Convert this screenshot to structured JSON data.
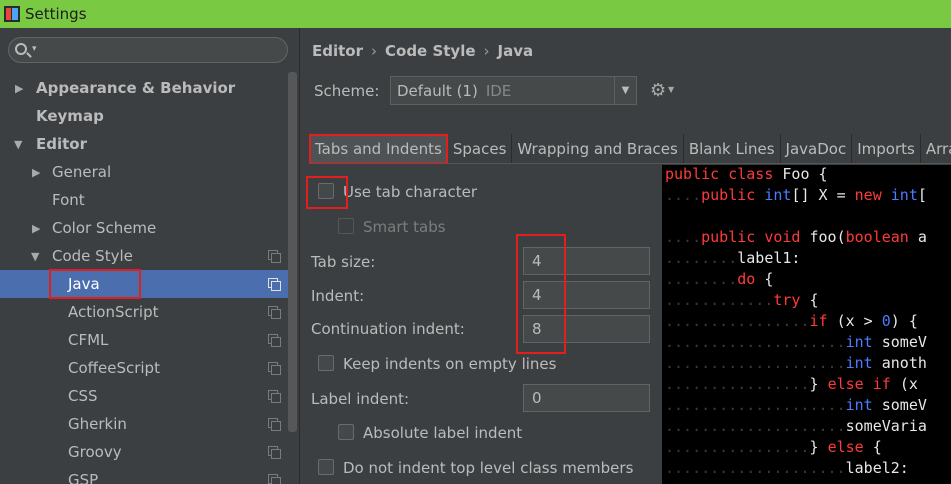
{
  "window": {
    "title": "Settings"
  },
  "sidebar": {
    "search_placeholder": "",
    "items": [
      {
        "label": "Appearance & Behavior",
        "level": 0,
        "arrow": "right",
        "bold": true
      },
      {
        "label": "Keymap",
        "level": 0,
        "arrow": "",
        "bold": true
      },
      {
        "label": "Editor",
        "level": 0,
        "arrow": "down",
        "bold": true
      },
      {
        "label": "General",
        "level": 1,
        "arrow": "right"
      },
      {
        "label": "Font",
        "level": 1,
        "arrow": ""
      },
      {
        "label": "Color Scheme",
        "level": 1,
        "arrow": "right"
      },
      {
        "label": "Code Style",
        "level": 1,
        "arrow": "down",
        "copy_icon": true
      },
      {
        "label": "Java",
        "level": 2,
        "selected": true,
        "copy_icon": true
      },
      {
        "label": "ActionScript",
        "level": 2,
        "copy_icon": true
      },
      {
        "label": "CFML",
        "level": 2,
        "copy_icon": true
      },
      {
        "label": "CoffeeScript",
        "level": 2,
        "copy_icon": true
      },
      {
        "label": "CSS",
        "level": 2,
        "copy_icon": true
      },
      {
        "label": "Gherkin",
        "level": 2,
        "copy_icon": true
      },
      {
        "label": "Groovy",
        "level": 2,
        "copy_icon": true
      },
      {
        "label": "GSP",
        "level": 2,
        "copy_icon": true
      }
    ]
  },
  "breadcrumb": [
    "Editor",
    "Code Style",
    "Java"
  ],
  "scheme": {
    "label": "Scheme:",
    "value": "Default (1)",
    "qualifier": "IDE"
  },
  "tabs": [
    "Tabs and Indents",
    "Spaces",
    "Wrapping and Braces",
    "Blank Lines",
    "JavaDoc",
    "Imports",
    "Arrange"
  ],
  "options": {
    "use_tab_character": "Use tab character",
    "smart_tabs": "Smart tabs",
    "tab_size_label": "Tab size:",
    "tab_size": "4",
    "indent_label": "Indent:",
    "indent": "4",
    "continuation_label": "Continuation indent:",
    "continuation": "8",
    "keep_indents": "Keep indents on empty lines",
    "label_indent_label": "Label indent:",
    "label_indent": "0",
    "absolute_label_indent": "Absolute label indent",
    "no_indent_top_level": "Do not indent top level class members"
  },
  "colors": {
    "title_bar": "#7ac943",
    "selection": "#4b6eaf",
    "highlight": "#e21f1f",
    "code_keyword": "#ff3a3a",
    "code_type": "#4b7bff"
  },
  "code_preview": [
    [
      [
        "kw",
        "public class "
      ],
      [
        "pl",
        "Foo {"
      ]
    ],
    [
      [
        "dots",
        "...."
      ],
      [
        "kw",
        "public "
      ],
      [
        "ty",
        "int"
      ],
      [
        "pl",
        "[] X = "
      ],
      [
        "kw",
        "new "
      ],
      [
        "ty",
        "int"
      ],
      [
        "pl",
        "["
      ]
    ],
    [
      [
        "pl",
        ""
      ]
    ],
    [
      [
        "dots",
        "...."
      ],
      [
        "kw",
        "public void "
      ],
      [
        "pl",
        "foo("
      ],
      [
        "kw",
        "boolean "
      ],
      [
        "pl",
        "a"
      ]
    ],
    [
      [
        "dots",
        "........"
      ],
      [
        "pl",
        "label1:"
      ]
    ],
    [
      [
        "dots",
        "........"
      ],
      [
        "kw",
        "do "
      ],
      [
        "pl",
        "{"
      ]
    ],
    [
      [
        "dots",
        "............"
      ],
      [
        "kw",
        "try "
      ],
      [
        "pl",
        "{"
      ]
    ],
    [
      [
        "dots",
        "................"
      ],
      [
        "kw",
        "if "
      ],
      [
        "pl",
        "(x > "
      ],
      [
        "num",
        "0"
      ],
      [
        "pl",
        ") {"
      ]
    ],
    [
      [
        "dots",
        "...................."
      ],
      [
        "ty",
        "int "
      ],
      [
        "pl",
        "someV"
      ]
    ],
    [
      [
        "dots",
        "...................."
      ],
      [
        "ty",
        "int "
      ],
      [
        "pl",
        "anoth"
      ]
    ],
    [
      [
        "dots",
        "................"
      ],
      [
        "pl",
        "} "
      ],
      [
        "kw",
        "else if "
      ],
      [
        "pl",
        "(x"
      ]
    ],
    [
      [
        "dots",
        "...................."
      ],
      [
        "ty",
        "int "
      ],
      [
        "pl",
        "someV"
      ]
    ],
    [
      [
        "dots",
        "...................."
      ],
      [
        "pl",
        "someVaria"
      ]
    ],
    [
      [
        "dots",
        "................"
      ],
      [
        "pl",
        "} "
      ],
      [
        "kw",
        "else "
      ],
      [
        "pl",
        "{"
      ]
    ],
    [
      [
        "dots",
        "...................."
      ],
      [
        "pl",
        "label2:"
      ]
    ]
  ]
}
